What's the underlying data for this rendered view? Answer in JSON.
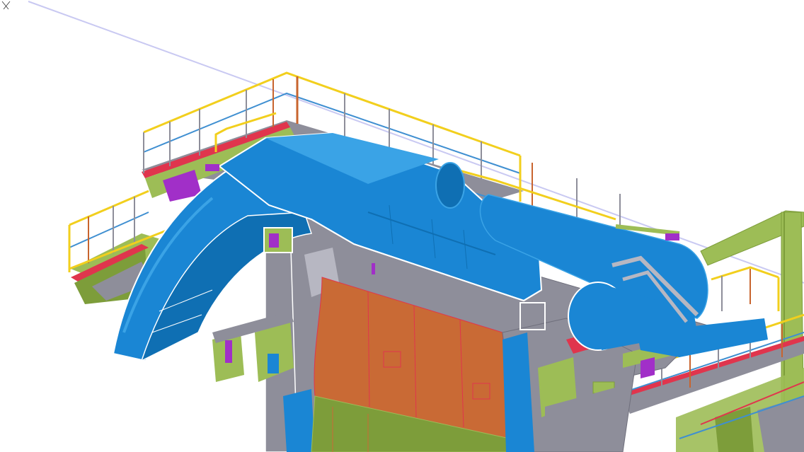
{
  "viewport": {
    "background": "#ffffff",
    "cursor_icon": "scissors-cursor-icon"
  },
  "colors": {
    "duct_blue": "#1a86d4",
    "duct_blue_dark": "#0f6fb3",
    "duct_blue_light": "#3aa3e6",
    "steel_grey": "#8e8e9a",
    "steel_grey_dark": "#6f6f7c",
    "handrail_yellow": "#f2cf1d",
    "handrail_blue": "#3f8fd1",
    "post_orange": "#c8642e",
    "deck_red": "#e0354d",
    "beam_green": "#9dbd56",
    "beam_green_dark": "#7d9d3a",
    "panel_orange": "#c96a35",
    "purple": "#a12fc8",
    "section_line": "#c9c9f2"
  }
}
